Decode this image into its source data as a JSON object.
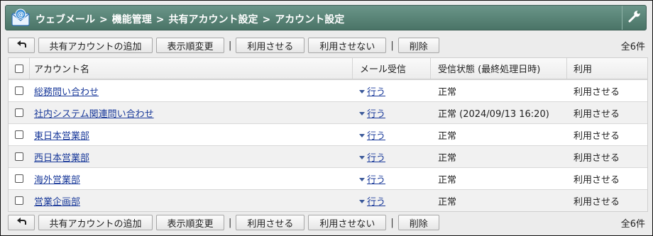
{
  "breadcrumb": [
    "ウェブメール",
    "機能管理",
    "共有アカウント設定",
    "アカウント設定"
  ],
  "breadcrumb_separator": ">",
  "toolbar": {
    "add_label": "共有アカウントの追加",
    "order_label": "表示順変更",
    "enable_label": "利用させる",
    "disable_label": "利用させない",
    "delete_label": "削除",
    "divider": "|",
    "count_label": "全6件"
  },
  "table": {
    "headers": {
      "name": "アカウント名",
      "mail": "メール受信",
      "status": "受信状態 (最終処理日時)",
      "use": "利用"
    },
    "rows": [
      {
        "name": "総務問い合わせ",
        "mail": "行う",
        "status": "正常",
        "use": "利用させる"
      },
      {
        "name": "社内システム関連問い合わせ",
        "mail": "行う",
        "status": "正常 (2024/09/13 16:20)",
        "use": "利用させる"
      },
      {
        "name": "東日本営業部",
        "mail": "行う",
        "status": "正常",
        "use": "利用させる"
      },
      {
        "name": "西日本営業部",
        "mail": "行う",
        "status": "正常",
        "use": "利用させる"
      },
      {
        "name": "海外営業部",
        "mail": "行う",
        "status": "正常",
        "use": "利用させる"
      },
      {
        "name": "営業企画部",
        "mail": "行う",
        "status": "正常",
        "use": "利用させる"
      }
    ]
  },
  "icons": {
    "app": "webmail-envelope-icon",
    "settings": "wrench-icon",
    "back": "back-arrow-icon",
    "mail_dropdown": "triangle-down-icon"
  },
  "colors": {
    "titlebar": "#5a8578",
    "link": "#1a3a9a",
    "row_alt": "#f1f1f1"
  }
}
